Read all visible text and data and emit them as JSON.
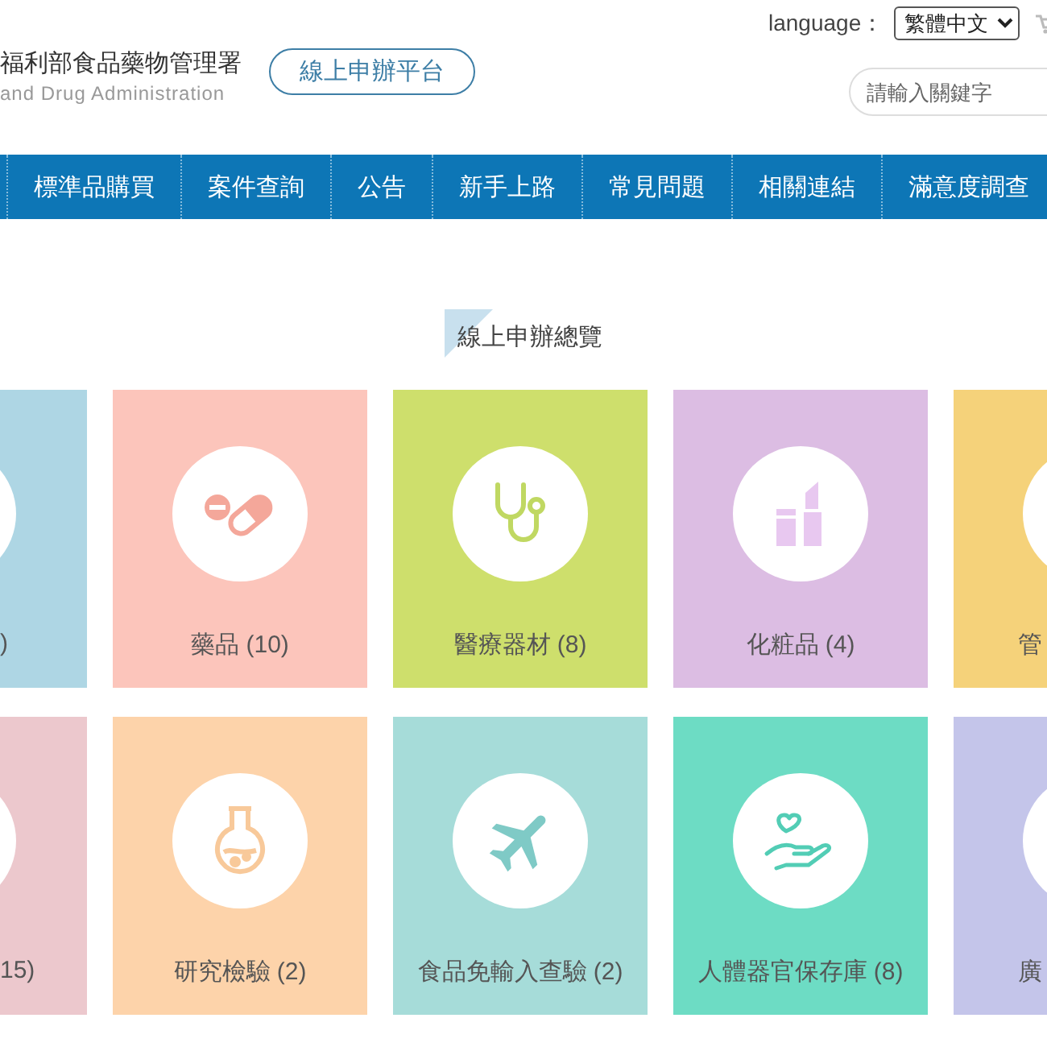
{
  "header": {
    "agency_name": "福利部食品藥物管理署",
    "agency_name_en": "and Drug Administration",
    "platform_button": "線上申辦平台",
    "language_label": "language：",
    "language_select": "繁體中文",
    "search": {
      "placeholder": "請輸入關鍵字"
    }
  },
  "nav": [
    "標準品購買",
    "案件查詢",
    "公告",
    "新手上路",
    "常見問題",
    "相關連結",
    "滿意度調查"
  ],
  "section_title": "線上申辦總覽",
  "cards": [
    {
      "kind": "cut_left",
      "label": ")",
      "color": "#aed6e4"
    },
    {
      "kind": "full",
      "label": "藥品 (10)",
      "color": "#fcc5bb"
    },
    {
      "kind": "full",
      "label": "醫療器材 (8)",
      "color": "#cedf6c"
    },
    {
      "kind": "full",
      "label": "化粧品 (4)",
      "color": "#dcbde3"
    },
    {
      "kind": "cut_right",
      "label": "管",
      "color": "#f5d27a"
    },
    {
      "kind": "cut_left",
      "label": "15)",
      "color": "#ecc8cd"
    },
    {
      "kind": "full",
      "label": "研究檢驗 (2)",
      "color": "#fdd3aa"
    },
    {
      "kind": "full",
      "label": "食品免輸入查驗 (2)",
      "color": "#a6dcd9"
    },
    {
      "kind": "full",
      "label": "人體器官保存庫 (8)",
      "color": "#6ddcc4"
    },
    {
      "kind": "cut_right",
      "label": "廣",
      "color": "#c4c5ea"
    }
  ]
}
